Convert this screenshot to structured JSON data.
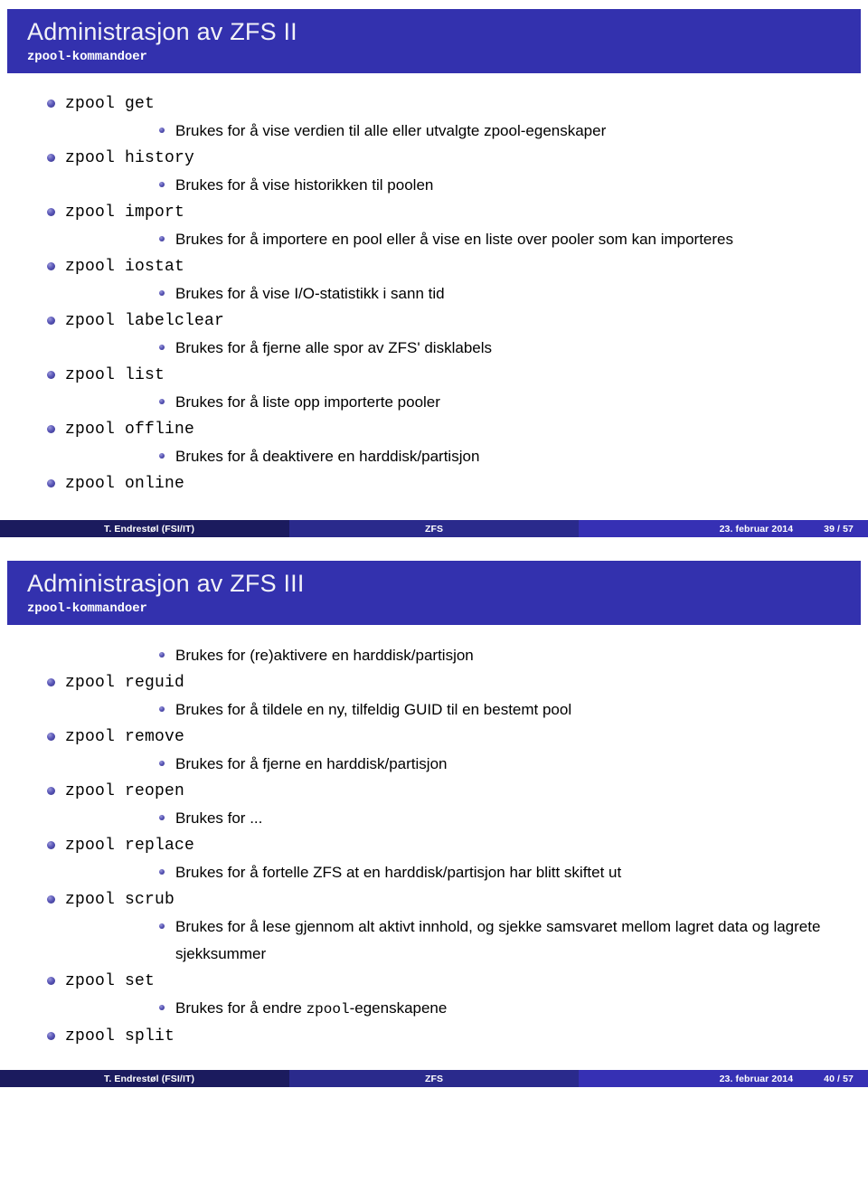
{
  "theme": {
    "header_blue": "#3331AE",
    "footer_left": "#1B1B5E",
    "footer_mid": "#2A2A8C",
    "footer_right": "#3630B4",
    "bullet_color": "#3F3C9B",
    "page_background": "#FFFFFF"
  },
  "slides": [
    {
      "title": "Administrasjon av ZFS II",
      "subtitle": "zpool-kommandoer",
      "items": [
        {
          "cmd": "zpool get",
          "desc": "Brukes for å vise verdien til alle eller utvalgte zpool-egenskaper"
        },
        {
          "cmd": "zpool history",
          "desc": "Brukes for å vise historikken til poolen"
        },
        {
          "cmd": "zpool import",
          "desc": "Brukes for å importere en pool eller å vise en liste over pooler som kan importeres"
        },
        {
          "cmd": "zpool iostat",
          "desc": "Brukes for å vise I/O-statistikk i sann tid"
        },
        {
          "cmd": "zpool labelclear",
          "desc": "Brukes for å fjerne alle spor av ZFS' disklabels"
        },
        {
          "cmd": "zpool list",
          "desc": "Brukes for å liste opp importerte pooler"
        },
        {
          "cmd": "zpool offline",
          "desc": "Brukes for å deaktivere en harddisk/partisjon"
        },
        {
          "cmd": "zpool online",
          "desc": ""
        }
      ],
      "footer": {
        "author": "T. Endrestøl  (FSI/IT)",
        "subject": "ZFS",
        "date": "23. februar 2014",
        "page": "39 / 57"
      }
    },
    {
      "title": "Administrasjon av ZFS III",
      "subtitle": "zpool-kommandoer",
      "lead_desc": "Brukes for (re)aktivere en harddisk/partisjon",
      "items": [
        {
          "cmd": "zpool reguid",
          "desc": "Brukes for å tildele en ny, tilfeldig GUID til en bestemt pool"
        },
        {
          "cmd": "zpool remove",
          "desc": "Brukes for å fjerne en harddisk/partisjon"
        },
        {
          "cmd": "zpool reopen",
          "desc": "Brukes for ..."
        },
        {
          "cmd": "zpool replace",
          "desc": "Brukes for å fortelle ZFS at en harddisk/partisjon har blitt skiftet ut"
        },
        {
          "cmd": "zpool scrub",
          "desc": "Brukes for å lese gjennom alt aktivt innhold, og sjekke samsvaret mellom lagret data og lagrete sjekksummer"
        },
        {
          "cmd": "zpool set",
          "desc_mono": "zpool",
          "desc_pre": "Brukes for å endre ",
          "desc_post": "-egenskapene"
        },
        {
          "cmd": "zpool split",
          "desc": ""
        }
      ],
      "footer": {
        "author": "T. Endrestøl  (FSI/IT)",
        "subject": "ZFS",
        "date": "23. februar 2014",
        "page": "40 / 57"
      }
    }
  ]
}
